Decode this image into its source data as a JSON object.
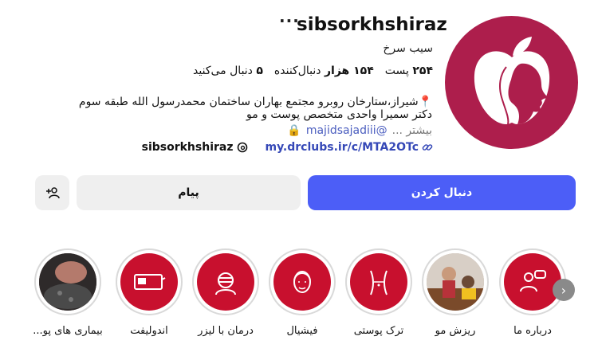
{
  "profile": {
    "username": "sibsorkhshiraz",
    "more_glyph": "···",
    "full_name": "سیب سرخ",
    "stats": {
      "posts_value": "۲۵۴",
      "posts_label": "پست",
      "followers_value": "۱۵۴ هزار",
      "followers_label": "دنبال‌کننده",
      "following_value": "۵",
      "following_label": "دنبال می‌کنید"
    },
    "bio_line1": "📍شیراز،ستارخان روبرو مجتمع بهاران ساختمان محمدرسول الله طبقه سوم",
    "bio_line2": "دکتر سمیرا واحدی متخصص پوست و مو",
    "more_label": "بیشتر ...",
    "mention": "@majidsajadiii",
    "link_text": "my.drclubs.ir/c/MTA2OTc",
    "threads_handle": "sibsorkhshiraz"
  },
  "actions": {
    "follow_label": "دنبال کردن",
    "message_label": "پیام"
  },
  "highlights": [
    {
      "label": "درباره ما"
    },
    {
      "label": "ریزش مو"
    },
    {
      "label": "ترک پوستی"
    },
    {
      "label": "فیشیال"
    },
    {
      "label": "درمان با لیزر"
    },
    {
      "label": "اندولیفت"
    },
    {
      "label": "بیماری های پو..."
    }
  ],
  "colors": {
    "brand": "#ad1e4c",
    "highlight_bg": "#c8102e",
    "follow_button": "#4c5ef7"
  }
}
